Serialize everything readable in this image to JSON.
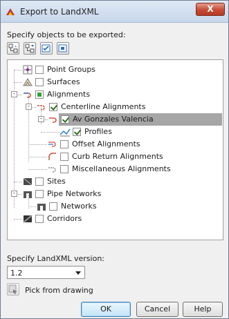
{
  "window": {
    "title": "Export to LandXML",
    "close_label": "X"
  },
  "objects_label": "Specify objects to be exported:",
  "toolbar": {
    "buttons": [
      {
        "icon": "expand-all-icon"
      },
      {
        "icon": "collapse-all-icon"
      },
      {
        "icon": "select-all-icon"
      },
      {
        "icon": "clear-all-icon"
      }
    ]
  },
  "tree": {
    "nodes": [
      {
        "label": "Point Groups",
        "state": "unchecked",
        "icon": "point-groups-icon"
      },
      {
        "label": "Surfaces",
        "state": "unchecked",
        "icon": "surfaces-icon"
      },
      {
        "label": "Alignments",
        "state": "partial",
        "icon": "alignments-icon",
        "expanded": true
      },
      {
        "label": "Centerline Alignments",
        "state": "checked",
        "icon": "centerline-alignment-icon",
        "expanded": true
      },
      {
        "label": "Av Gonzales Valencia",
        "state": "checked",
        "icon": "alignment-icon",
        "expanded": true,
        "selected": true
      },
      {
        "label": "Profiles",
        "state": "checked",
        "icon": "profiles-icon"
      },
      {
        "label": "Offset Alignments",
        "state": "unchecked",
        "icon": "offset-alignment-icon"
      },
      {
        "label": "Curb Return Alignments",
        "state": "unchecked",
        "icon": "curb-return-icon"
      },
      {
        "label": "Miscellaneous Alignments",
        "state": "unchecked",
        "icon": "misc-alignment-icon"
      },
      {
        "label": "Sites",
        "state": "unchecked",
        "icon": "sites-icon"
      },
      {
        "label": "Pipe Networks",
        "state": "unchecked",
        "icon": "pipe-networks-icon",
        "expanded": true
      },
      {
        "label": "Networks",
        "state": "unchecked",
        "icon": "networks-icon"
      },
      {
        "label": "Corridors",
        "state": "unchecked",
        "icon": "corridors-icon"
      }
    ]
  },
  "version": {
    "label": "Specify LandXML version:",
    "value": "1.2"
  },
  "pick": {
    "label": "Pick from drawing"
  },
  "buttons": {
    "ok": "OK",
    "cancel": "Cancel",
    "help": "Help"
  }
}
